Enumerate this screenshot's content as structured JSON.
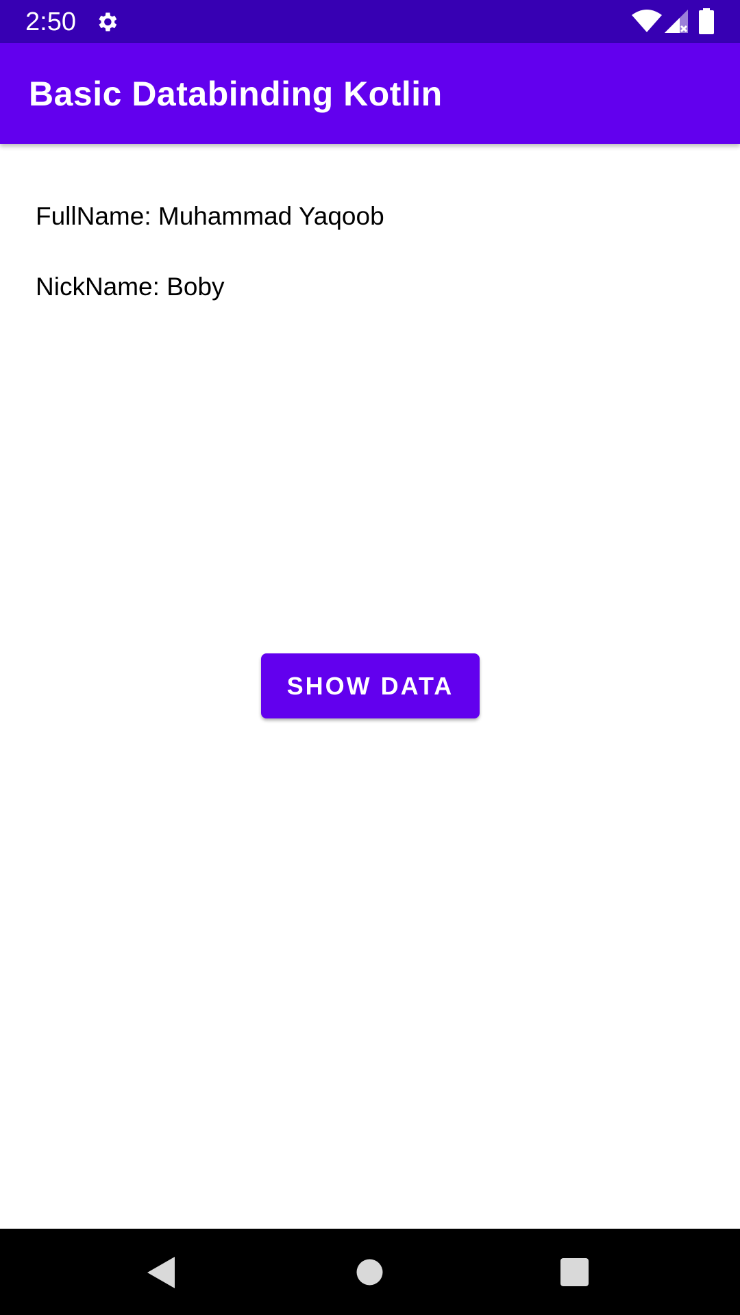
{
  "status_bar": {
    "time": "2:50",
    "icons": [
      "settings-gear-icon",
      "wifi-icon",
      "cell-signal-icon",
      "battery-icon"
    ],
    "color": "#3700b3"
  },
  "app_bar": {
    "title": "Basic Databinding Kotlin",
    "color": "#6200ee"
  },
  "main": {
    "full_name": "FullName: Muhammad Yaqoob",
    "nick_name": "NickName: Boby",
    "show_button_label": "SHOW DATA"
  },
  "nav_bar": {
    "icons": [
      "back-icon",
      "home-icon",
      "recents-icon"
    ]
  }
}
